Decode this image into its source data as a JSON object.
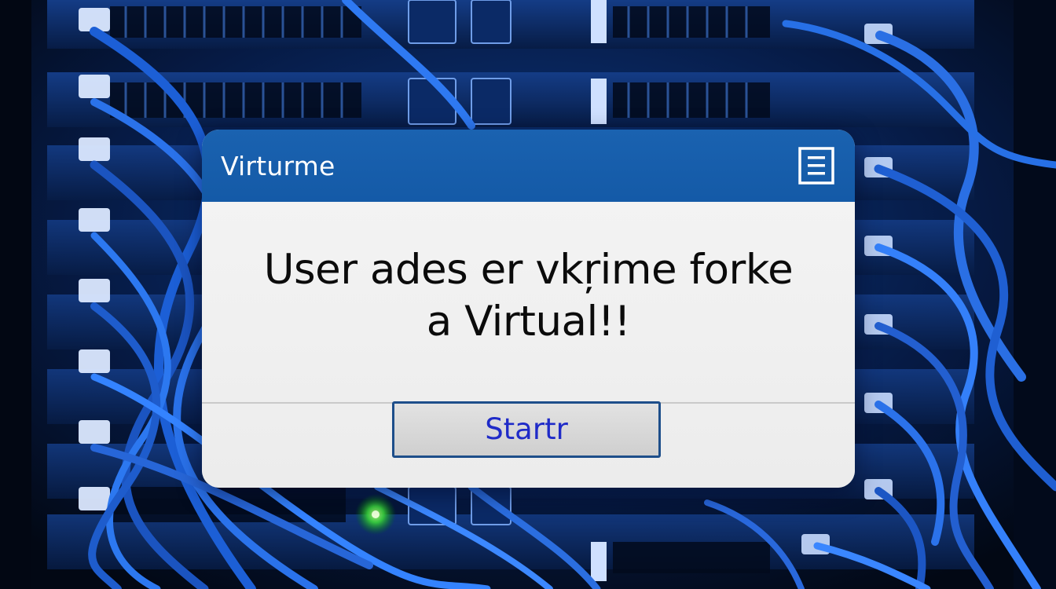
{
  "dialog": {
    "title": "Virturme",
    "menu_icon": "menu-icon",
    "message_line1": "User ades er vkŗime forke",
    "message_line2": "a Virtual!!",
    "button_label": "Startr"
  },
  "colors": {
    "titlebar": "#145aa7",
    "dialog_body": "#efefef",
    "button_text": "#1f2bc8",
    "button_border": "#1d4e8a",
    "background": "#030c1c"
  }
}
